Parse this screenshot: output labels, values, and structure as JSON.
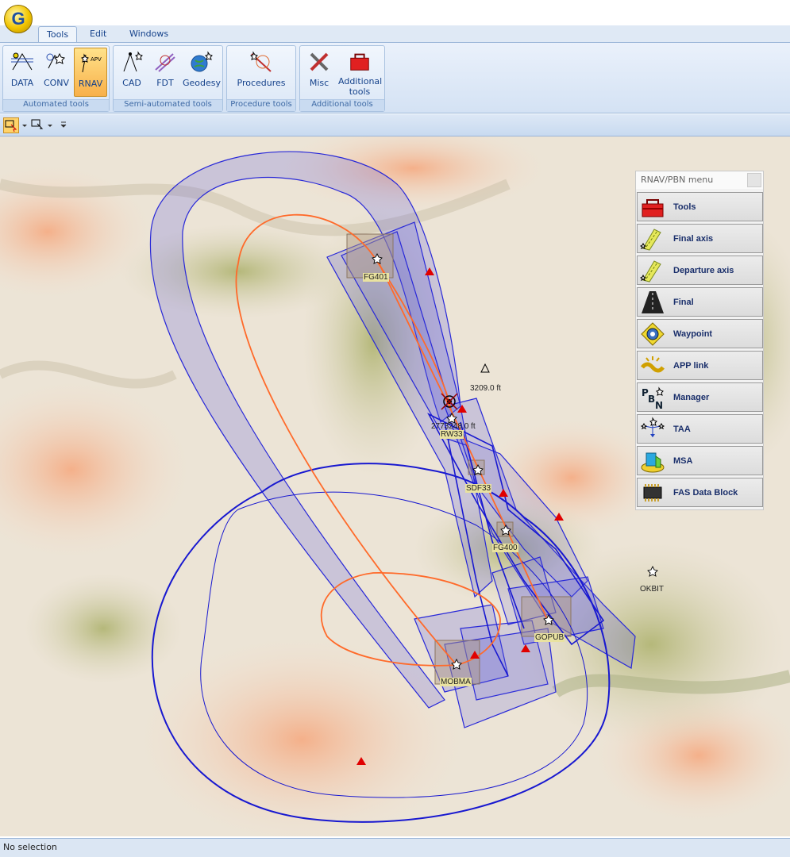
{
  "app": {
    "logo": "G"
  },
  "tabs": [
    {
      "label": "Tools"
    },
    {
      "label": "Edit"
    },
    {
      "label": "Windows"
    }
  ],
  "ribbon": {
    "groups": [
      {
        "label": "Automated tools",
        "buttons": [
          {
            "label": "DATA"
          },
          {
            "label": "CONV"
          },
          {
            "label": "RNAV",
            "selected": true
          }
        ]
      },
      {
        "label": "Semi-automated tools",
        "buttons": [
          {
            "label": "CAD"
          },
          {
            "label": "FDT"
          },
          {
            "label": "Geodesy"
          }
        ]
      },
      {
        "label": "Procedure tools",
        "buttons": [
          {
            "label": "Procedures"
          }
        ]
      },
      {
        "label": "Additional tools",
        "buttons": [
          {
            "label": "Misc"
          },
          {
            "label": "Additional tools"
          }
        ]
      }
    ]
  },
  "rnav_menu": {
    "title": "RNAV/PBN menu",
    "items": [
      {
        "label": "Tools",
        "icon": "toolbox-icon"
      },
      {
        "label": "Final axis",
        "icon": "final-axis-icon"
      },
      {
        "label": "Departure axis",
        "icon": "departure-axis-icon"
      },
      {
        "label": "Final",
        "icon": "final-icon"
      },
      {
        "label": "Waypoint",
        "icon": "waypoint-icon"
      },
      {
        "label": "APP link",
        "icon": "app-link-icon"
      },
      {
        "label": "Manager",
        "icon": "pbn-manager-icon"
      },
      {
        "label": "TAA",
        "icon": "taa-icon"
      },
      {
        "label": "MSA",
        "icon": "msa-icon"
      },
      {
        "label": "FAS Data Block",
        "icon": "fas-data-block-icon"
      }
    ]
  },
  "map": {
    "waypoints": [
      "FG401",
      "RW33",
      "SDF33",
      "FG400",
      "GOPUB",
      "MOBMA",
      "OKBIT"
    ],
    "elevations": [
      "3209.0 ft",
      "2773248.0 ft"
    ]
  },
  "status": {
    "text": "No selection"
  },
  "colors": {
    "ribbon": "#d4e2f4",
    "protection_area": "#5050e0",
    "track": "#ff6a2a",
    "obstacle": "#e00000"
  }
}
